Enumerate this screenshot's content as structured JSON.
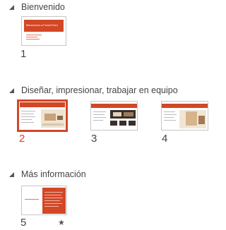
{
  "sections": [
    {
      "title": "Bienvenido",
      "slides": [
        {
          "number": "1",
          "thumb_title": "Bienvenido a PowerPoint"
        }
      ]
    },
    {
      "title": "Diseñar, impresionar, trabajar en equipo",
      "slides": [
        {
          "number": "2",
          "selected": true
        },
        {
          "number": "3"
        },
        {
          "number": "4"
        }
      ]
    },
    {
      "title": "Más información",
      "slides": [
        {
          "number": "5",
          "has_animation": true,
          "animation_marker": "★"
        }
      ]
    }
  ],
  "colors": {
    "accent": "#d24726",
    "accent_light": "#e8795b",
    "text": "#444444",
    "thumb_border": "#c6c6c6"
  },
  "icons": {
    "section_toggle": "collapse-triangle-icon",
    "animation": "star-icon"
  }
}
